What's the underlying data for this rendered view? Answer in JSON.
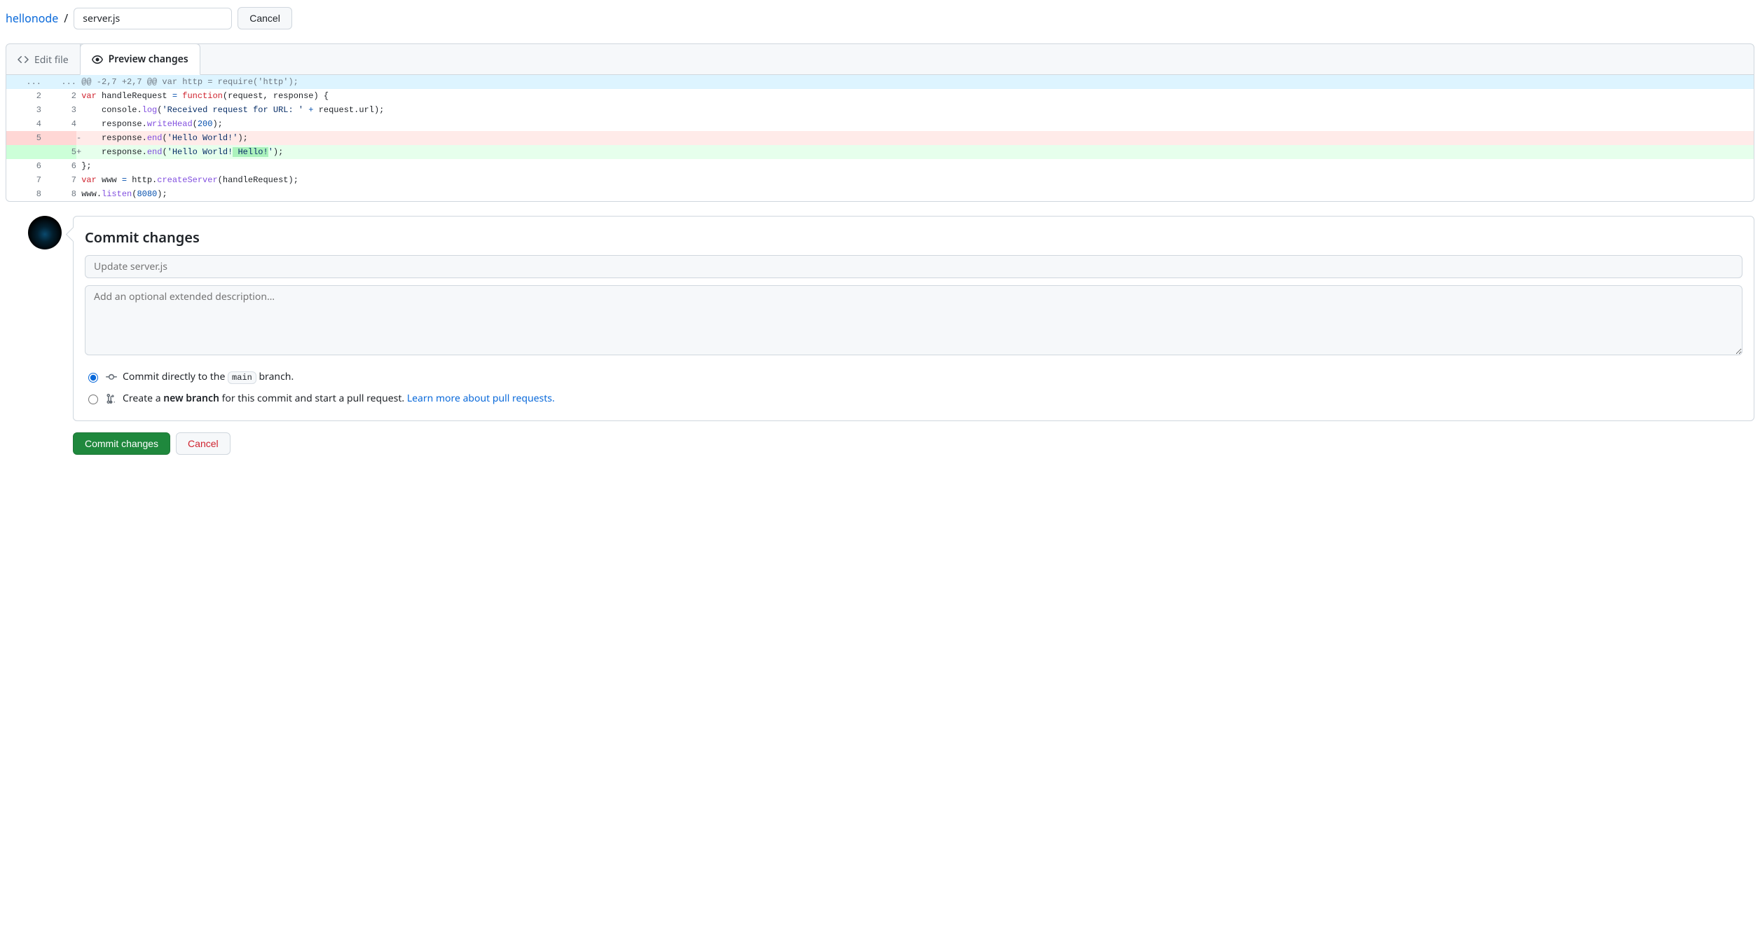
{
  "breadcrumb": {
    "repo": "hellonode",
    "separator": "/",
    "filename": "server.js",
    "cancel": "Cancel"
  },
  "tabs": {
    "edit": "Edit file",
    "preview": "Preview changes"
  },
  "diff": {
    "hunk_header": "@@ -2,7 +2,7 @@ var http = require('http');",
    "lines": [
      {
        "type": "ctx",
        "old": "2",
        "new": "2",
        "tokens": [
          {
            "t": "var ",
            "c": "kw"
          },
          {
            "t": "handleRequest",
            "c": ""
          },
          {
            "t": " ",
            "c": ""
          },
          {
            "t": "=",
            "c": "blue"
          },
          {
            "t": " ",
            "c": ""
          },
          {
            "t": "function",
            "c": "kw"
          },
          {
            "t": "(",
            "c": ""
          },
          {
            "t": "request",
            "c": ""
          },
          {
            "t": ", ",
            "c": ""
          },
          {
            "t": "response",
            "c": ""
          },
          {
            "t": ") {",
            "c": ""
          }
        ]
      },
      {
        "type": "ctx",
        "old": "3",
        "new": "3",
        "tokens": [
          {
            "t": "    ",
            "c": ""
          },
          {
            "t": "console",
            "c": ""
          },
          {
            "t": ".",
            "c": ""
          },
          {
            "t": "log",
            "c": "fn"
          },
          {
            "t": "(",
            "c": ""
          },
          {
            "t": "'Received request for URL: '",
            "c": "str"
          },
          {
            "t": " ",
            "c": ""
          },
          {
            "t": "+",
            "c": "blue"
          },
          {
            "t": " ",
            "c": ""
          },
          {
            "t": "request",
            "c": ""
          },
          {
            "t": ".",
            "c": ""
          },
          {
            "t": "url",
            "c": ""
          },
          {
            "t": ");",
            "c": ""
          }
        ]
      },
      {
        "type": "ctx",
        "old": "4",
        "new": "4",
        "tokens": [
          {
            "t": "    ",
            "c": ""
          },
          {
            "t": "response",
            "c": ""
          },
          {
            "t": ".",
            "c": ""
          },
          {
            "t": "writeHead",
            "c": "fn"
          },
          {
            "t": "(",
            "c": ""
          },
          {
            "t": "200",
            "c": "num"
          },
          {
            "t": ");",
            "c": ""
          }
        ]
      },
      {
        "type": "del",
        "old": "5",
        "new": "",
        "tokens": [
          {
            "t": "    ",
            "c": ""
          },
          {
            "t": "response",
            "c": ""
          },
          {
            "t": ".",
            "c": ""
          },
          {
            "t": "end",
            "c": "fn"
          },
          {
            "t": "(",
            "c": ""
          },
          {
            "t": "'Hello World!'",
            "c": "str"
          },
          {
            "t": ");",
            "c": ""
          }
        ]
      },
      {
        "type": "add",
        "old": "",
        "new": "5",
        "tokens": [
          {
            "t": "    ",
            "c": ""
          },
          {
            "t": "response",
            "c": ""
          },
          {
            "t": ".",
            "c": ""
          },
          {
            "t": "end",
            "c": "fn"
          },
          {
            "t": "(",
            "c": ""
          },
          {
            "t": "'Hello World!",
            "c": "str"
          },
          {
            "t": " Hello!",
            "c": "str wadd"
          },
          {
            "t": "'",
            "c": "str"
          },
          {
            "t": ");",
            "c": ""
          }
        ]
      },
      {
        "type": "ctx",
        "old": "6",
        "new": "6",
        "tokens": [
          {
            "t": "};",
            "c": ""
          }
        ]
      },
      {
        "type": "ctx",
        "old": "7",
        "new": "7",
        "tokens": [
          {
            "t": "var ",
            "c": "kw"
          },
          {
            "t": "www",
            "c": ""
          },
          {
            "t": " ",
            "c": ""
          },
          {
            "t": "=",
            "c": "blue"
          },
          {
            "t": " ",
            "c": ""
          },
          {
            "t": "http",
            "c": ""
          },
          {
            "t": ".",
            "c": ""
          },
          {
            "t": "createServer",
            "c": "fn"
          },
          {
            "t": "(",
            "c": ""
          },
          {
            "t": "handleRequest",
            "c": ""
          },
          {
            "t": ");",
            "c": ""
          }
        ]
      },
      {
        "type": "ctx",
        "old": "8",
        "new": "8",
        "tokens": [
          {
            "t": "www",
            "c": ""
          },
          {
            "t": ".",
            "c": ""
          },
          {
            "t": "listen",
            "c": "fn"
          },
          {
            "t": "(",
            "c": ""
          },
          {
            "t": "8080",
            "c": "num"
          },
          {
            "t": ");",
            "c": ""
          }
        ]
      }
    ]
  },
  "commit": {
    "heading": "Commit changes",
    "summary_placeholder": "Update server.js",
    "description_placeholder": "Add an optional extended description…",
    "direct_prefix": "Commit directly to the ",
    "branch_name": "main",
    "direct_suffix": " branch.",
    "pr_prefix": "Create a ",
    "pr_bold": "new branch",
    "pr_middle": " for this commit and start a pull request. ",
    "pr_link": "Learn more about pull requests.",
    "submit": "Commit changes",
    "cancel": "Cancel"
  }
}
